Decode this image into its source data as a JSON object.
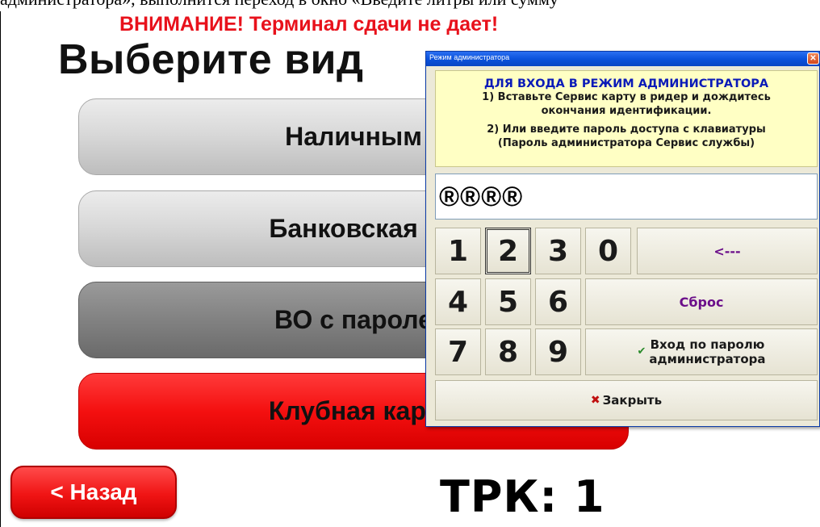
{
  "doc_caption": "администратора», выполнится переход в окно «Введите литры или сумму",
  "kiosk": {
    "warning": "ВНИМАНИЕ! Терминал сдачи не дает!",
    "heading": "Выберите вид",
    "payment_buttons": [
      {
        "label": "Наличным"
      },
      {
        "label": "Банковская к"
      },
      {
        "label": "ВО с пароле"
      },
      {
        "label": "Клубная карт"
      }
    ],
    "back_label": "< Назад",
    "pump_label": "ТРК: 1"
  },
  "admin_dialog": {
    "title": "Режим администратора",
    "info_title": "ДЛЯ ВХОДА В РЕЖИМ АДМИНИСТРАТОРА",
    "info_lines": [
      "1) Вставьте Сервис карту в ридер и дождитесь",
      "окончания идентификации.",
      "2) Или введите пароль доступа с клавиатуры",
      "(Пароль администратора Сервис службы)"
    ],
    "password_value": "®®®®",
    "keys": {
      "k1": "1",
      "k2": "2",
      "k3": "3",
      "k0": "0",
      "k4": "4",
      "k5": "5",
      "k6": "6",
      "k7": "7",
      "k8": "8",
      "k9": "9",
      "backspace": "<---",
      "reset": "Сброс",
      "login_line1": "Вход по паролю",
      "login_line2": "администратора",
      "close": "Закрыть"
    },
    "colors": {
      "info_title": "#0a1ab8",
      "action_text": "#6b0f8a",
      "warning": "#e8111b"
    }
  }
}
